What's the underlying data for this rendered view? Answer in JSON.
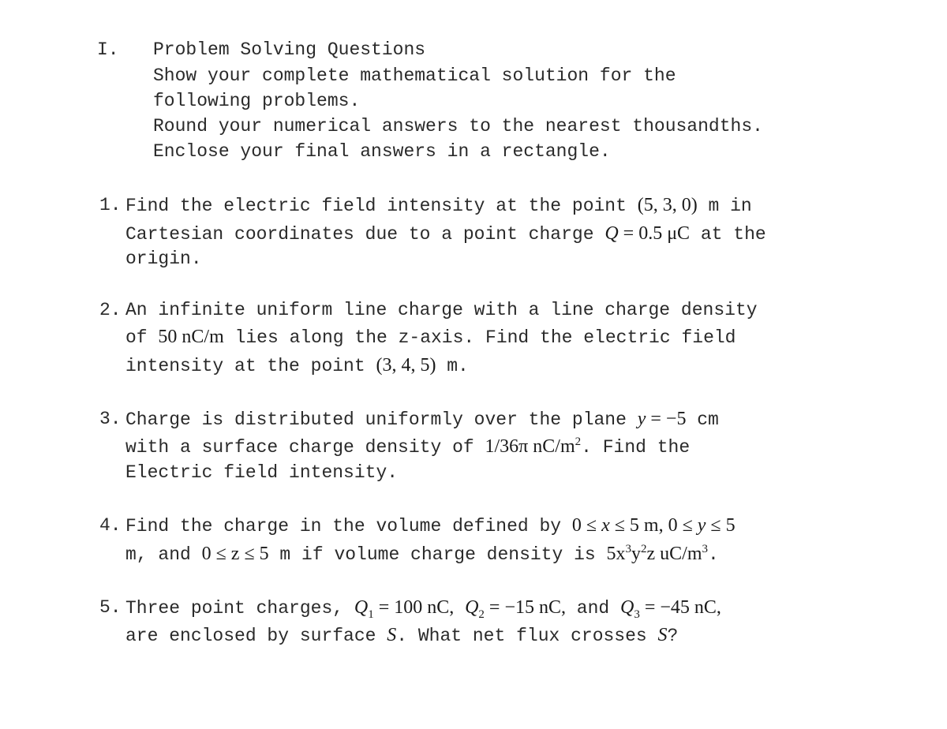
{
  "section": {
    "number": "I.",
    "title": "Problem Solving Questions",
    "instructions": [
      "Show your complete mathematical solution for the",
      "following problems.",
      "Round your numerical answers to the nearest thousandths.",
      "Enclose your final answers in a rectangle."
    ]
  },
  "questions": [
    {
      "number": "1.",
      "l1a": "Find the electric field intensity at the point ",
      "l1m": "(5, 3, 0)",
      "l1b": " m in",
      "l2a": "Cartesian coordinates due to a point charge ",
      "l2q": "Q",
      "l2m": " = 0.5 μC",
      "l2b": " at the",
      "l3": "origin."
    },
    {
      "number": "2.",
      "l1": "An infinite uniform line charge with a line charge density",
      "l2a": "of ",
      "l2m": "50 nC/m",
      "l2b": " lies along the z-axis. Find the electric field",
      "l3a": "intensity at the point ",
      "l3m": "(3, 4, 5)",
      "l3b": " m."
    },
    {
      "number": "3.",
      "l1a": "Charge is distributed uniformly over the plane ",
      "l1v": "y",
      "l1m": " = −5",
      "l1b": " cm",
      "l2a": "with a surface charge density of ",
      "l2m": "1/36π nC/m",
      "l2sup": "2",
      "l2b": ". Find the",
      "l3": "Electric field intensity."
    },
    {
      "number": "4.",
      "l1a": "Find the charge in the volume defined by ",
      "l1m1": "0 ≤ ",
      "l1x": "x",
      "l1m2": " ≤ 5 m,",
      "l1m3": " 0 ≤ ",
      "l1y": "y",
      "l1m4": " ≤ 5",
      "l2a": "m, and ",
      "l2m1": "0 ≤ z ≤ 5",
      "l2b": " m if volume charge density is ",
      "l2m2": "5x",
      "l2s1": "3",
      "l2m3": "y",
      "l2s2": "2",
      "l2m4": "z uC/m",
      "l2s3": "3",
      "l2c": "."
    },
    {
      "number": "5.",
      "l1a": "Three point charges, ",
      "q1": "Q",
      "q1sub": "1",
      "q1val": " = 100 nC,",
      "q2": "Q",
      "q2sub": "2",
      "q2val": " = −15 nC,",
      "and": " and ",
      "q3": "Q",
      "q3sub": "3",
      "q3val": " = −45 nC,",
      "l2a": "are enclosed by surface ",
      "s1": "S",
      "l2b": ". What net flux crosses ",
      "s2": "S",
      "l2c": "?"
    }
  ]
}
